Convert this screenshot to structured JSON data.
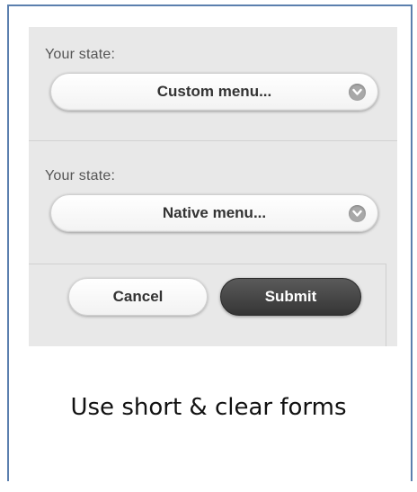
{
  "form": {
    "field1": {
      "label": "Your state:",
      "select_value": "Custom menu...",
      "icon": "chevron-down-icon"
    },
    "field2": {
      "label": "Your state:",
      "select_value": "Native menu...",
      "icon": "chevron-down-icon"
    },
    "actions": {
      "cancel_label": "Cancel",
      "submit_label": "Submit"
    }
  },
  "caption": "Use short & clear forms",
  "colors": {
    "frame_border": "#5b7fae",
    "panel_bg": "#e8e8e8",
    "submit_bg": "#3f3f3f",
    "chevron_bg": "#a8a8a8"
  }
}
